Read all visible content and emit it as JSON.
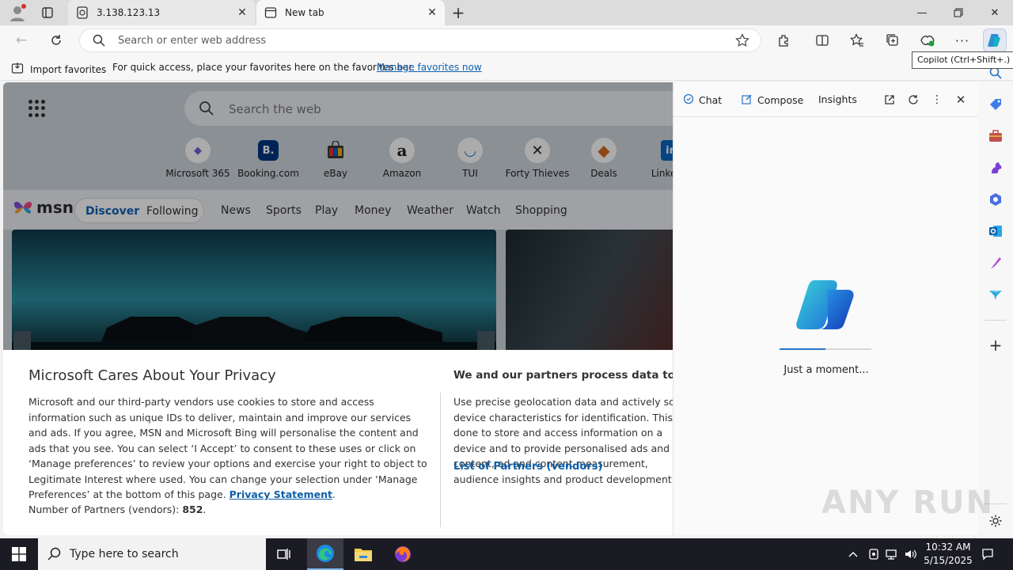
{
  "tabs": [
    {
      "title": "3.138.123.13",
      "icon": "page-icon"
    },
    {
      "title": "New tab",
      "icon": "new-tab-page-icon"
    }
  ],
  "address_bar": {
    "placeholder": "Search or enter web address"
  },
  "favorites_bar": {
    "import_label": "Import favorites",
    "hint": "For quick access, place your favorites here on the favorites bar.",
    "manage_link": "Manage favorites now"
  },
  "tooltip": "Copilot (Ctrl+Shift+.)",
  "newtab": {
    "search_placeholder": "Search the web",
    "quicklinks": [
      {
        "label": "Microsoft 365",
        "glyph": "◆",
        "color": "#7b5cd6"
      },
      {
        "label": "Booking.com",
        "glyph": "B.",
        "color": "#003580"
      },
      {
        "label": "eBay",
        "glyph": "▦",
        "color": "#e53238"
      },
      {
        "label": "Amazon",
        "glyph": "a",
        "color": "#111111"
      },
      {
        "label": "TUI",
        "glyph": "◡",
        "color": "#1a73c8"
      },
      {
        "label": "Forty Thieves",
        "glyph": "✕",
        "color": "#222222"
      },
      {
        "label": "Deals",
        "glyph": "◆",
        "color": "#d2691e"
      },
      {
        "label": "LinkedIn",
        "glyph": "in",
        "color": "#0a66c2"
      }
    ],
    "msn": {
      "logo": "msn",
      "discover": "Discover",
      "following": "Following",
      "nav": [
        "News",
        "Sports",
        "Play",
        "Money",
        "Weather",
        "Watch",
        "Shopping"
      ]
    }
  },
  "privacy": {
    "title": "Microsoft Cares About Your Privacy",
    "body": "Microsoft and our third-party vendors use cookies to store and access information such as unique IDs to deliver, maintain and improve our services and ads. If you agree, MSN and Microsoft Bing will personalise the content and ads that you see. You can select ‘I Accept’ to consent to these uses or click on ‘Manage preferences’ to review your options and exercise your right to object to Legitimate Interest where used.  You can change your selection under ‘Manage Preferences’ at the bottom of this page. ",
    "privacy_link": "Privacy Statement",
    "body_end": ".",
    "partners_label": "Number of Partners (vendors): ",
    "partners_count": "852",
    "partners_end": ".",
    "right_title": "We and our partners process data to provide:",
    "right_body": "Use precise geolocation data and actively scan device characteristics for identification. This is done to store and access information on a device and to provide personalised ads and content, ad and content measurement, audience insights and product development.",
    "vendors_link": "List of Partners (vendors)"
  },
  "copilot": {
    "tabs": [
      "Chat",
      "Compose",
      "Insights"
    ],
    "loading_text": "Just a moment...",
    "progress": 0.5
  },
  "watermark": "ANY RUN",
  "taskbar": {
    "search_placeholder": "Type here to search",
    "time": "10:32 AM",
    "date": "5/15/2025"
  },
  "colors": {
    "accent": "#0f62b6",
    "copilot_blue": "#2773c9",
    "taskbar": "#1b1c23"
  }
}
